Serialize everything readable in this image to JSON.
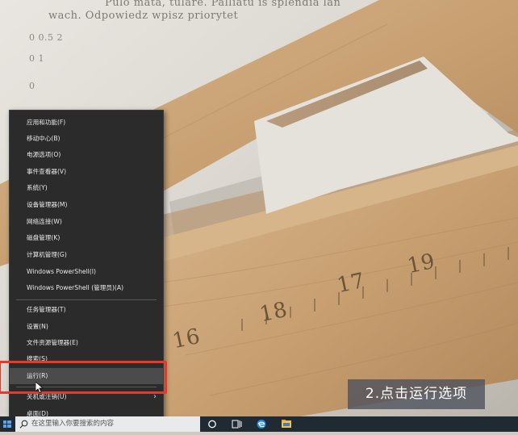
{
  "menu": {
    "items": [
      {
        "label": "应用和功能(F)"
      },
      {
        "label": "移动中心(B)"
      },
      {
        "label": "电源选项(O)"
      },
      {
        "label": "事件查看器(V)"
      },
      {
        "label": "系统(Y)"
      },
      {
        "label": "设备管理器(M)"
      },
      {
        "label": "网络连接(W)"
      },
      {
        "label": "磁盘管理(K)"
      },
      {
        "label": "计算机管理(G)"
      },
      {
        "label": "Windows PowerShell(I)"
      },
      {
        "label": "Windows PowerShell (管理员)(A)"
      },
      {
        "label": "任务管理器(T)"
      },
      {
        "label": "设置(N)"
      },
      {
        "label": "文件资源管理器(E)"
      },
      {
        "label": "搜索(S)"
      },
      {
        "label": "运行(R)"
      },
      {
        "label": "关机或注销(U)"
      },
      {
        "label": "桌面(D)"
      }
    ],
    "highlighted_index": 15
  },
  "caption": "2.点击运行选项",
  "taskbar": {
    "search_placeholder": "在这里输入你要搜索的内容",
    "icons": [
      "windows-start-icon",
      "cortana-icon",
      "task-view-icon",
      "edge-icon",
      "file-explorer-icon"
    ]
  },
  "wallpaper": {
    "paper_lines": [
      "Pulo mata, tulare. Palliatu is splendia lan",
      "wach. Odpowiedz wpisz priorytet",
      "0        0.5        2",
      "0        1",
      "0"
    ],
    "ruler_numbers": [
      "16",
      "17",
      "18",
      "19"
    ]
  },
  "colors": {
    "menu_bg": "#2b2b2b",
    "menu_text": "#eaeaea",
    "highlight_box": "#e23a2c",
    "taskbar_bg": "#1f2a33",
    "caption_bg": "#4b505c"
  }
}
